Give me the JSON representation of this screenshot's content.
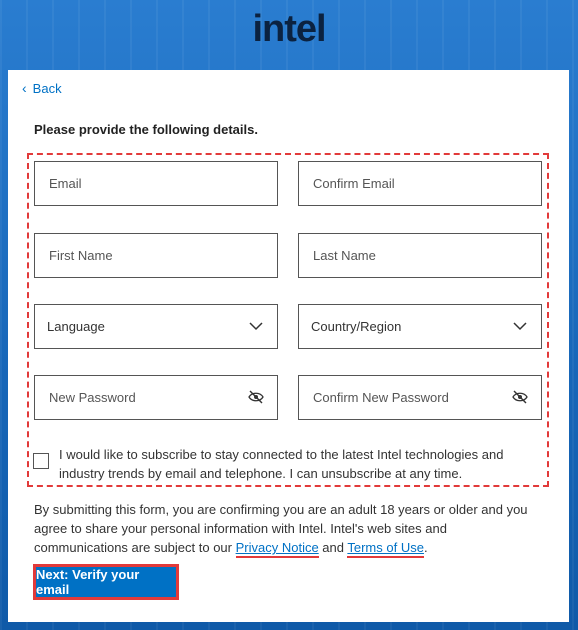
{
  "brand": {
    "logo_text": "intel",
    "accent": "#0071c5",
    "highlight": "#e23a3a"
  },
  "nav": {
    "back_label": "Back"
  },
  "form": {
    "heading": "Please provide the following details.",
    "fields": {
      "email": {
        "placeholder": "Email",
        "value": ""
      },
      "confirm_email": {
        "placeholder": "Confirm Email",
        "value": ""
      },
      "first_name": {
        "placeholder": "First Name",
        "value": ""
      },
      "last_name": {
        "placeholder": "Last Name",
        "value": ""
      },
      "language": {
        "placeholder": "Language",
        "icon": "chevron-down-icon"
      },
      "country": {
        "placeholder": "Country/Region",
        "icon": "chevron-down-icon"
      },
      "new_password": {
        "placeholder": "New Password",
        "value": "",
        "icon": "eye-off-icon"
      },
      "confirm_password": {
        "placeholder": "Confirm New Password",
        "value": "",
        "icon": "eye-off-icon"
      }
    },
    "consent": {
      "checked": false,
      "text": "I would like to subscribe to stay connected to the latest Intel technologies and industry trends by email and telephone. I can unsubscribe at any time."
    },
    "disclaimer": {
      "prefix": "By submitting this form, you are confirming you are an adult 18 years or older and you agree to share your personal information with Intel. Intel's web sites and communications are subject to our ",
      "privacy_link": "Privacy Notice",
      "middle": " and ",
      "terms_link": "Terms of Use",
      "suffix": "."
    },
    "submit_label": "Next: Verify your email"
  }
}
